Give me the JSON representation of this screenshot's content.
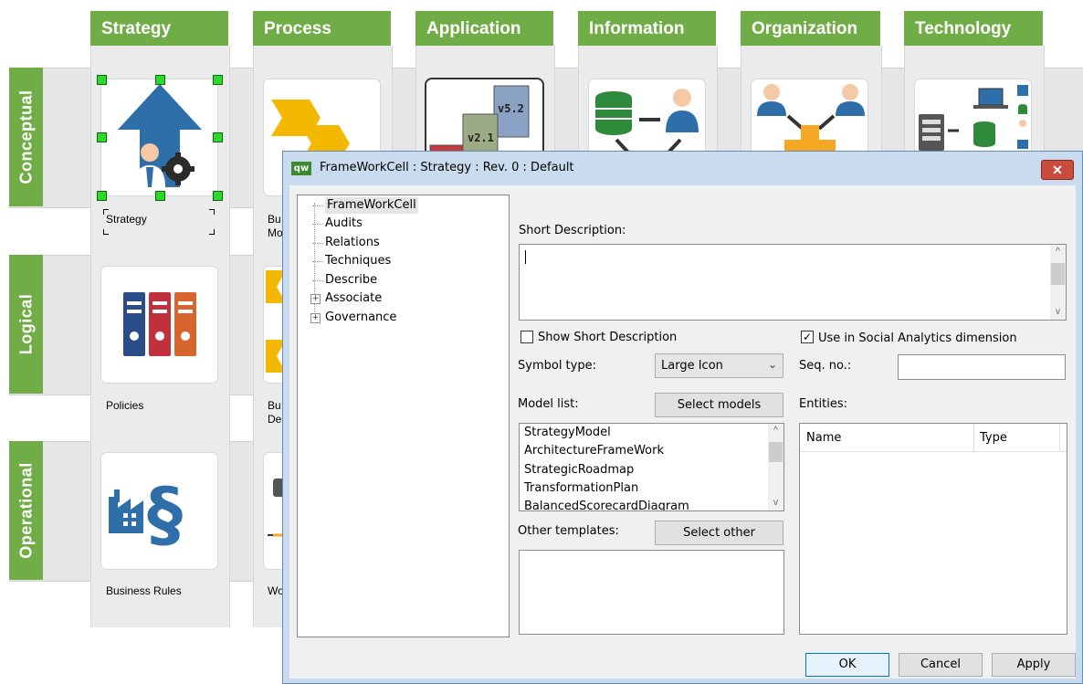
{
  "framework": {
    "columns": [
      "Strategy",
      "Process",
      "Application",
      "Information",
      "Organization",
      "Technology"
    ],
    "rows": [
      "Conceptual",
      "Logical",
      "Operational"
    ],
    "cells": {
      "conceptual_strategy": "Strategy",
      "conceptual_process": "Bu\nMo",
      "logical_strategy": "Policies",
      "logical_process": "Bu\nDe",
      "operational_strategy": "Business Rules",
      "operational_process": "Wo"
    },
    "version_labels": [
      "v5.2",
      "v2.1"
    ],
    "colors": {
      "header_green": "#71ad47",
      "selection_green": "#2bd82b",
      "icon_blue": "#2e6faa",
      "icon_orange": "#f5a623"
    }
  },
  "dialog": {
    "title": "FrameWorkCell : Strategy : Rev. 0  : Default",
    "app_icon": "qw",
    "tree": [
      "FrameWorkCell",
      "Audits",
      "Relations",
      "Techniques",
      "Describe",
      "Associate",
      "Governance"
    ],
    "short_description_label": "Short Description:",
    "short_description_value": "",
    "show_short_description_label": "Show Short Description",
    "show_short_description_checked": false,
    "use_social_label": "Use in Social Analytics dimension",
    "use_social_checked": true,
    "symbol_type_label": "Symbol type:",
    "symbol_type_value": "Large Icon",
    "seq_no_label": "Seq. no.:",
    "seq_no_value": "",
    "model_list_label": "Model list:",
    "select_models_button": "Select models",
    "model_list": [
      "StrategyModel",
      "ArchitectureFrameWork",
      "StrategicRoadmap",
      "TransformationPlan",
      "BalancedScorecardDiagram"
    ],
    "entities_label": "Entities:",
    "entities_columns": [
      "Name",
      "Type"
    ],
    "other_templates_label": "Other templates:",
    "select_other_button": "Select other",
    "ok_button": "OK",
    "cancel_button": "Cancel",
    "apply_button": "Apply"
  }
}
